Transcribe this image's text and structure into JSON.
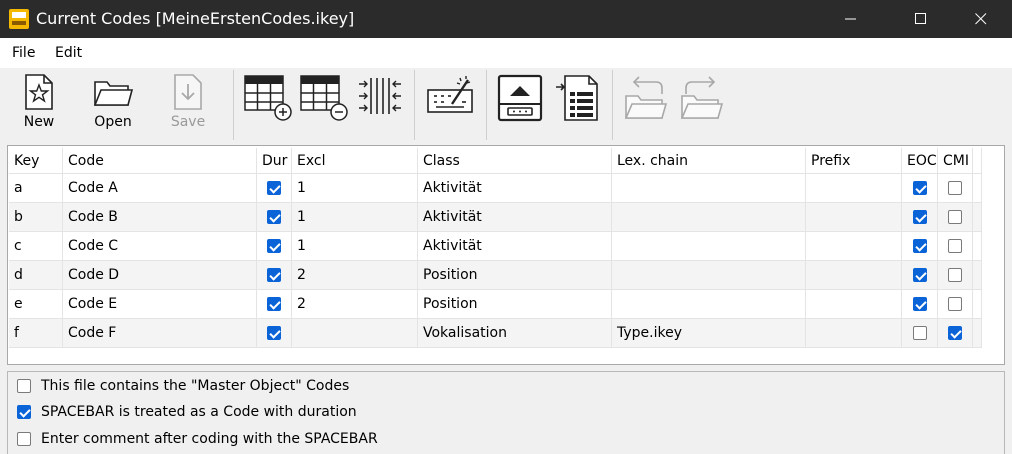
{
  "window": {
    "title": "Current Codes [MeineErstenCodes.ikey]"
  },
  "menu": {
    "file": "File",
    "edit": "Edit"
  },
  "toolbar": {
    "new_label": "New",
    "open_label": "Open",
    "save_label": "Save"
  },
  "table": {
    "columns": [
      "Key",
      "Code",
      "Dur",
      "Excl",
      "Class",
      "Lex. chain",
      "Prefix",
      "EOC",
      "CMI"
    ],
    "rows": [
      {
        "key": "a",
        "code": "Code A",
        "dur": true,
        "excl": "1",
        "class": "Aktivität",
        "lex": "",
        "prefix": "",
        "eoc": true,
        "cmi": false
      },
      {
        "key": "b",
        "code": "Code B",
        "dur": true,
        "excl": "1",
        "class": "Aktivität",
        "lex": "",
        "prefix": "",
        "eoc": true,
        "cmi": false
      },
      {
        "key": "c",
        "code": "Code C",
        "dur": true,
        "excl": "1",
        "class": "Aktivität",
        "lex": "",
        "prefix": "",
        "eoc": true,
        "cmi": false
      },
      {
        "key": "d",
        "code": "Code D",
        "dur": true,
        "excl": "2",
        "class": "Position",
        "lex": "",
        "prefix": "",
        "eoc": true,
        "cmi": false
      },
      {
        "key": "e",
        "code": "Code E",
        "dur": true,
        "excl": "2",
        "class": "Position",
        "lex": "",
        "prefix": "",
        "eoc": true,
        "cmi": false
      },
      {
        "key": "f",
        "code": "Code F",
        "dur": true,
        "excl": "",
        "class": "Vokalisation",
        "lex": "Type.ikey",
        "prefix": "",
        "eoc": false,
        "cmi": true
      }
    ]
  },
  "options": {
    "master_object": {
      "label": "This file contains the \"Master Object\" Codes",
      "checked": false
    },
    "spacebar_duration": {
      "label": "SPACEBAR is treated as a Code with duration",
      "checked": true
    },
    "comment_after": {
      "label": "Enter comment after coding with the SPACEBAR",
      "checked": false
    }
  },
  "colors": {
    "titlebar": "#2b2b2b",
    "accent": "#0a64d8",
    "app_icon": "#f5b800"
  }
}
